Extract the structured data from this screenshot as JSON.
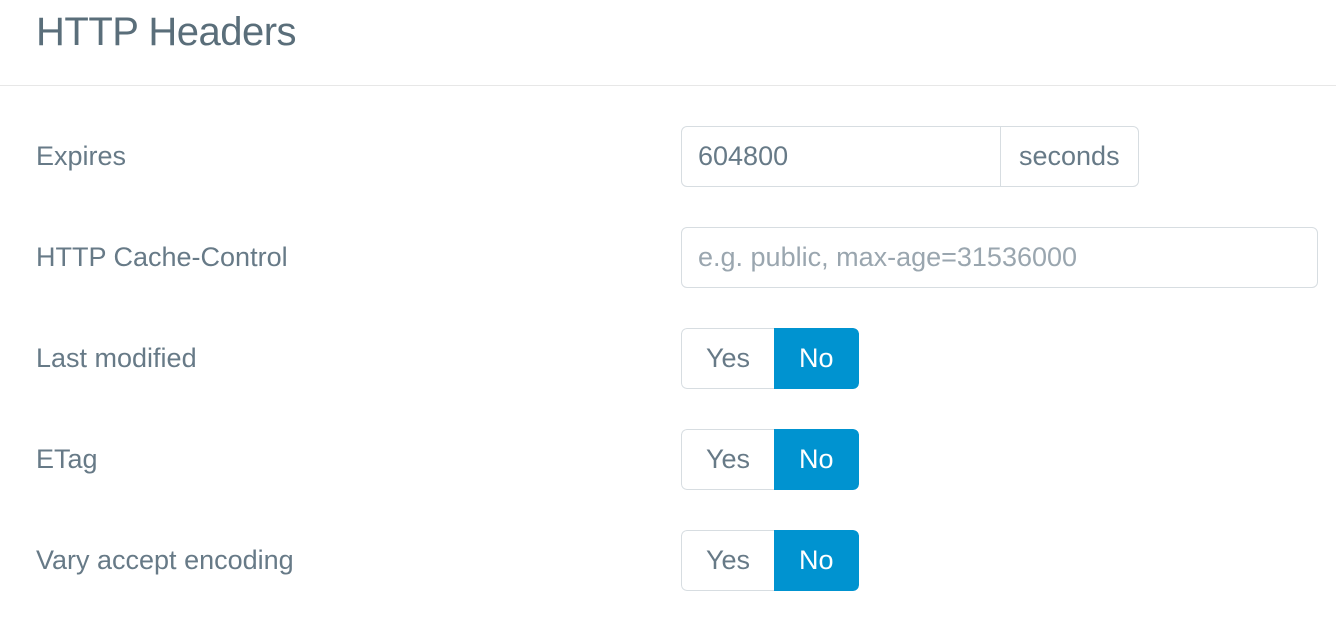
{
  "header": {
    "title": "HTTP Headers"
  },
  "form": {
    "expires": {
      "label": "Expires",
      "value": "604800",
      "unit": "seconds"
    },
    "cacheControl": {
      "label": "HTTP Cache-Control",
      "value": "",
      "placeholder": "e.g. public, max-age=31536000"
    },
    "lastModified": {
      "label": "Last modified",
      "yes": "Yes",
      "no": "No",
      "selected": "no"
    },
    "etag": {
      "label": "ETag",
      "yes": "Yes",
      "no": "No",
      "selected": "no"
    },
    "varyAcceptEncoding": {
      "label": "Vary accept encoding",
      "yes": "Yes",
      "no": "No",
      "selected": "no"
    }
  }
}
